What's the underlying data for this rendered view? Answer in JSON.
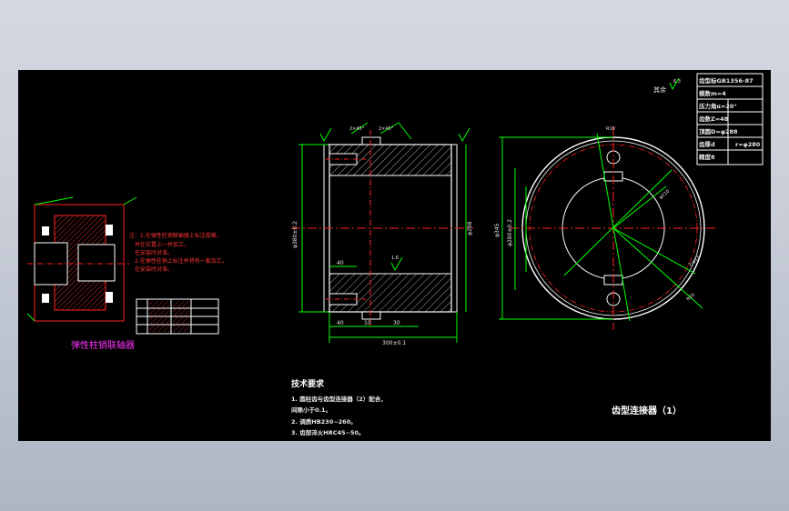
{
  "drawing": {
    "title": "齿型连接器（1）",
    "left_caption": "弹性柱销联轴器",
    "roughness_note": "其余",
    "roughness_value": "6.3"
  },
  "param_table": [
    {
      "label": "齿型标GB1356-87"
    },
    {
      "label": "模数m=4"
    },
    {
      "label": "压力角α=20°"
    },
    {
      "label": "齿数Z=48"
    },
    {
      "label": "顶圆D=φ288"
    },
    {
      "label": "齿厚d",
      "value": "r=φ280"
    },
    {
      "label": "精度8"
    }
  ],
  "tech_requirements": {
    "heading": "技术要求",
    "items": [
      "1. 圆柱齿与齿型连接器（2）配合，",
      "   间隙小于0.1。",
      "2. 调质HB230~260。",
      "3. 齿部淬火HRC45~50。"
    ]
  },
  "left_notes": [
    "注：1.在弹性柱销联轴器上标注规格，",
    "  并在位置上一并加工，",
    "  在安装时对准。",
    "2.在弹性柱销上标注并将有一套加工，",
    "  在安装时对准。"
  ],
  "dimensions": {
    "front_left_dia": "φ380±0.2",
    "front_right_dia": "φ288",
    "front_top_key1": "2×45°",
    "front_top_key2": "2×45°",
    "front_hole_dim": "40",
    "front_bottom_a": "40",
    "front_bottom_b": "10",
    "front_bottom_c": "30",
    "front_total": "300±0.1",
    "side_outer": "φ345",
    "side_inner": "φ280±0.2",
    "side_pcd": "φ210",
    "side_hole": "2-φ13",
    "side_r1": "R20",
    "side_r2": "R10",
    "roughness_front": "1.6"
  },
  "colors": {
    "outline": "#ffffff",
    "dimension": "#00ff00",
    "centerline": "#ff2222",
    "hatch": "#ffffff",
    "part_red": "#ff2020",
    "caption": "#ff33ff"
  }
}
